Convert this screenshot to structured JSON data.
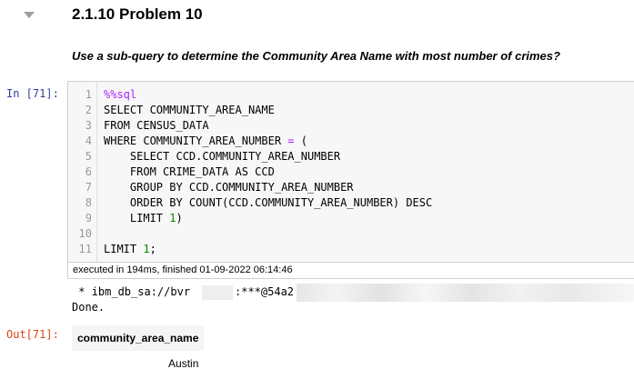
{
  "heading": {
    "number": "2.1.10",
    "title": "Problem 10",
    "text": "2.1.10  Problem 10"
  },
  "question": "Use a sub-query to determine the Community Area Name with most number of crimes?",
  "input_cell": {
    "prompt": "In [71]:",
    "lines": [
      {
        "num": "1",
        "text": "%%sql"
      },
      {
        "num": "2",
        "text": "SELECT COMMUNITY_AREA_NAME"
      },
      {
        "num": "3",
        "text": "FROM CENSUS_DATA"
      },
      {
        "num": "4",
        "text": "WHERE COMMUNITY_AREA_NUMBER = ("
      },
      {
        "num": "5",
        "text": "    SELECT CCD.COMMUNITY_AREA_NUMBER"
      },
      {
        "num": "6",
        "text": "    FROM CRIME_DATA AS CCD"
      },
      {
        "num": "7",
        "text": "    GROUP BY CCD.COMMUNITY_AREA_NUMBER"
      },
      {
        "num": "8",
        "text": "    ORDER BY COUNT(CCD.COMMUNITY_AREA_NUMBER) DESC"
      },
      {
        "num": "9",
        "text": "    LIMIT 1)"
      },
      {
        "num": "10",
        "text": ""
      },
      {
        "num": "11",
        "text": "LIMIT 1;"
      }
    ],
    "execution_info": "executed in 194ms, finished 01-09-2022 06:14:46"
  },
  "stdout": {
    "connection_line_start": " * ibm_db_sa://bvr",
    "connection_line_mid": ":***@54a2",
    "done": "Done."
  },
  "output_cell": {
    "prompt": "Out[71]:",
    "table": {
      "columns": [
        "community_area_name"
      ],
      "rows": [
        [
          "Austin"
        ]
      ]
    }
  },
  "colors": {
    "prompt_in": "#303f9f",
    "prompt_out": "#d84315",
    "sql_magic": "#aa22ff",
    "number": "#008800"
  }
}
